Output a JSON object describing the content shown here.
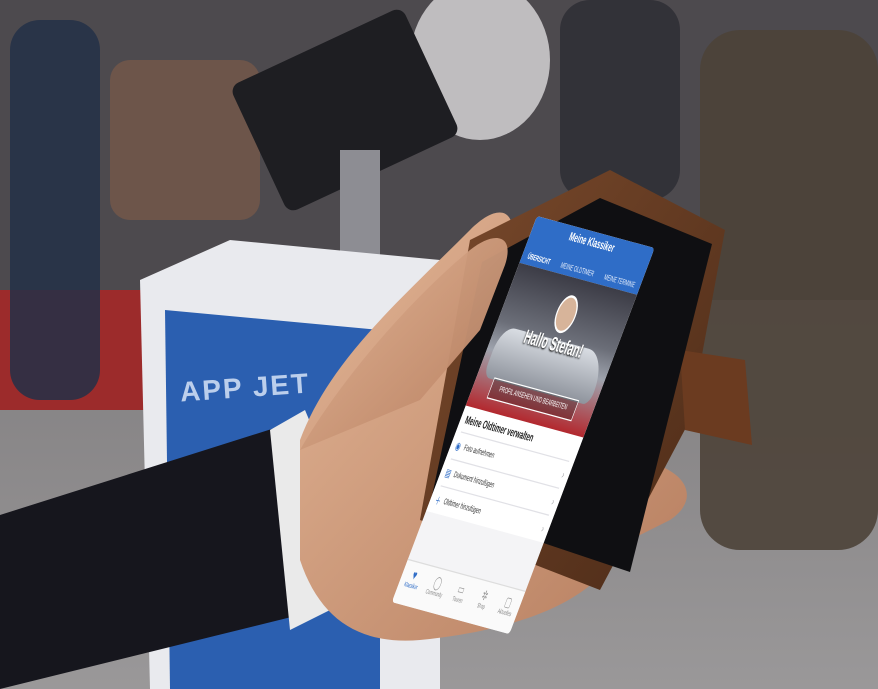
{
  "background": {
    "banner_text": "APP JET"
  },
  "phone": {
    "header_title": "Meine Klassiker",
    "tabs": [
      {
        "label": "ÜBERSICHT",
        "active": true
      },
      {
        "label": "MEINE OLDTIMER",
        "active": false
      },
      {
        "label": "MEINE TERMINE",
        "active": false
      }
    ],
    "greeting": "Hallo Stefan!",
    "profile_button": "PROFIL ANSEHEN UND BEARBEITEN",
    "section_title": "Meine Oldtimer verwalten",
    "rows": [
      {
        "icon": "camera-icon",
        "label": "Foto aufnehmen"
      },
      {
        "icon": "document-icon",
        "label": "Dokument hinzufügen"
      },
      {
        "icon": "plus-icon",
        "label": "Oldtimer hinzufügen"
      }
    ],
    "tabbar": [
      {
        "icon": "heart-icon",
        "label": "Klassiker",
        "active": true
      },
      {
        "icon": "chat-icon",
        "label": "Community",
        "active": false
      },
      {
        "icon": "book-icon",
        "label": "Touren",
        "active": false
      },
      {
        "icon": "gear-icon",
        "label": "Shop",
        "active": false
      },
      {
        "icon": "ticket-icon",
        "label": "Aktuelles",
        "active": false
      }
    ],
    "accent_color": "#2f6dc7"
  }
}
